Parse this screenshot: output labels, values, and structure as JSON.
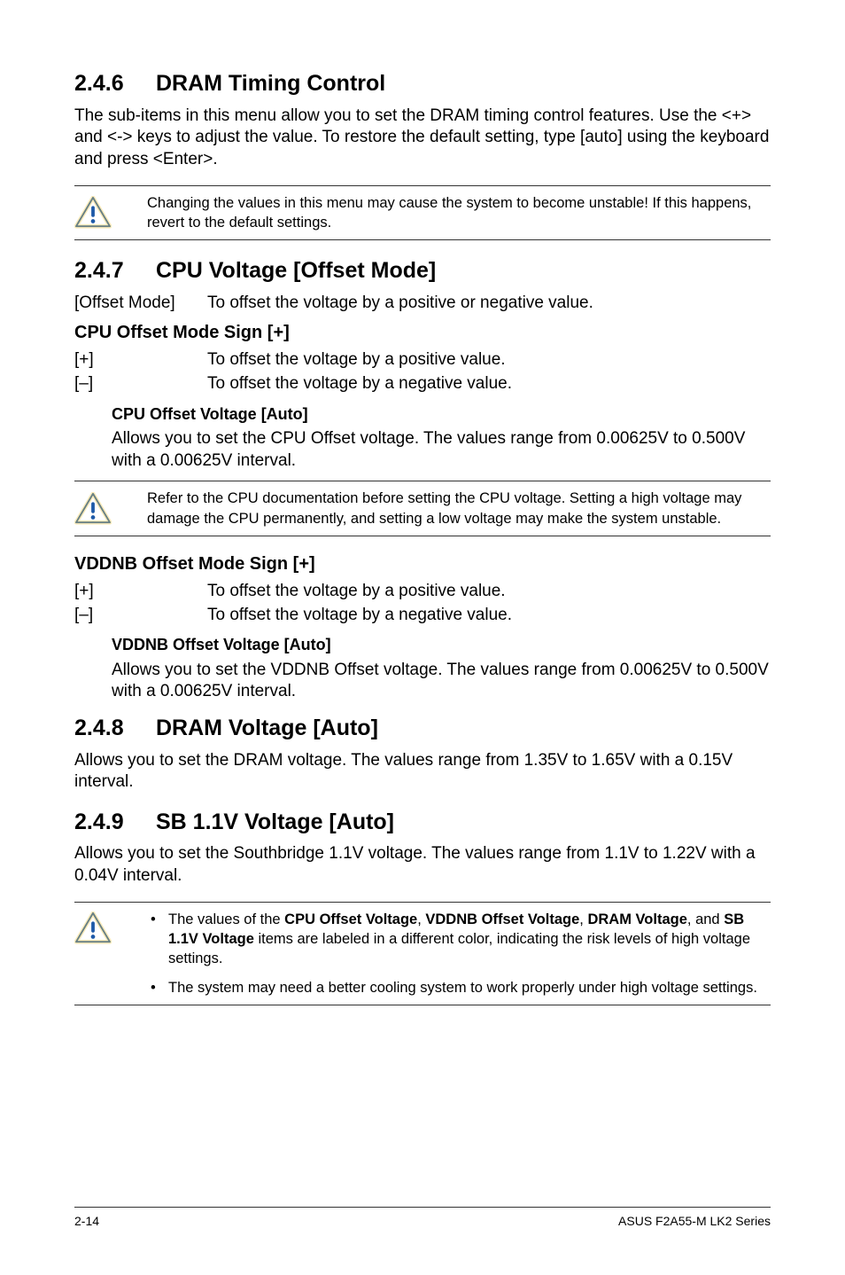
{
  "s1": {
    "num": "2.4.6",
    "title": "DRAM Timing Control",
    "body": "The sub-items in this menu allow you to set the DRAM timing control features. Use the <+> and <-> keys to adjust the value. To restore the default setting, type [auto] using the keyboard and press <Enter>.",
    "note": "Changing the values in this menu may cause the system to become unstable! If this happens, revert to the default settings."
  },
  "s2": {
    "num": "2.4.7",
    "title": "CPU Voltage [Offset Mode]",
    "row1_key": "[Offset Mode]",
    "row1_val": "To offset the voltage by a positive or negative value.",
    "sub1_title": "CPU Offset Mode Sign [+]",
    "sub1_r1_key": "[+]",
    "sub1_r1_val": "To offset the voltage by a positive value.",
    "sub1_r2_key": "[–]",
    "sub1_r2_val": "To offset the voltage by a negative value.",
    "subsub1_title": "CPU Offset Voltage [Auto]",
    "subsub1_body": "Allows you to set the CPU Offset voltage. The values range from 0.00625V to 0.500V with a 0.00625V interval.",
    "note": "Refer to the CPU documentation before setting the CPU voltage. Setting a high voltage may damage the CPU permanently, and setting a low voltage may make the system unstable.",
    "sub2_title": "VDDNB Offset Mode Sign [+]",
    "sub2_r1_key": "[+]",
    "sub2_r1_val": "To offset the voltage by a positive value.",
    "sub2_r2_key": "[–]",
    "sub2_r2_val": "To offset the voltage by a negative value.",
    "subsub2_title": "VDDNB Offset Voltage [Auto]",
    "subsub2_body": "Allows you to set the VDDNB Offset voltage. The values range from 0.00625V to 0.500V with a 0.00625V interval."
  },
  "s3": {
    "num": "2.4.8",
    "title": "DRAM Voltage [Auto]",
    "body": "Allows you to set the DRAM voltage. The values range from 1.35V to 1.65V with a 0.15V interval."
  },
  "s4": {
    "num": "2.4.9",
    "title": "SB 1.1V Voltage [Auto]",
    "body": "Allows you to set the Southbridge 1.1V voltage. The values range from 1.1V to 1.22V with a 0.04V interval.",
    "note_b1_pre": "The values of the ",
    "note_b1_bold1": "CPU Offset Voltage",
    "note_b1_sep1": ", ",
    "note_b1_bold2": "VDDNB Offset Voltage",
    "note_b1_sep2": ", ",
    "note_b1_bold3": "DRAM Voltage",
    "note_b1_sep3": ", and ",
    "note_b1_bold4": "SB 1.1V Voltage",
    "note_b1_post": " items are labeled in a different color, indicating the risk levels of high voltage settings.",
    "note_b2": "The system may need a better cooling system to work properly under high voltage settings."
  },
  "footer": {
    "page": "2-14",
    "doc": "ASUS F2A55-M LK2 Series"
  }
}
